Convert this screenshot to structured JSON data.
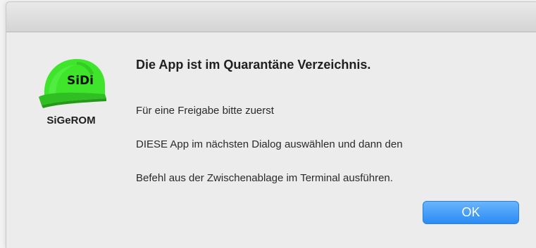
{
  "dialog": {
    "app_name": "SiGeROM",
    "icon_logo_text": "SiDi",
    "icon": "helmet-icon",
    "title": "Die App ist im Quarantäne Verzeichnis.",
    "messages": [
      "Für eine Freigabe bitte zuerst",
      "DIESE App im nächsten Dialog auswählen und dann den",
      "Befehl aus der Zwischenablage im Terminal ausführen."
    ],
    "ok_label": "OK"
  },
  "colors": {
    "helmet": "#3ee52b",
    "button_accent": "#2a8bf5"
  }
}
